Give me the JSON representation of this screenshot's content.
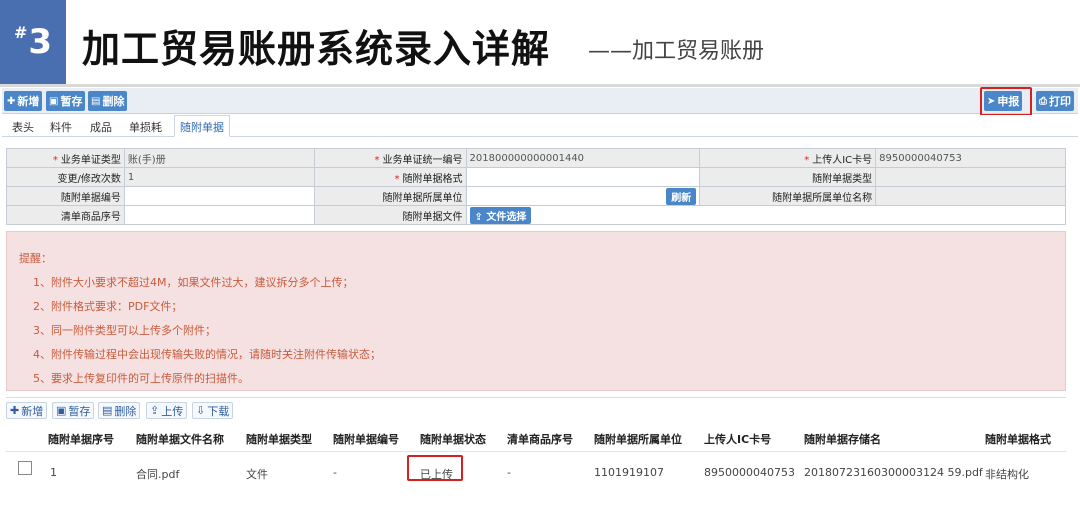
{
  "banner": {
    "badge_hash": "#",
    "badge_num": "3",
    "title": "加工贸易账册系统录入详解",
    "subtitle": "——加工贸易账册"
  },
  "toolbar": {
    "add": "新增",
    "save": "暂存",
    "delete": "删除",
    "declare": "申报",
    "print": "打印"
  },
  "tabs": [
    "表头",
    "料件",
    "成品",
    "单损耗",
    "随附单据"
  ],
  "form": {
    "row1": {
      "l1": "业务单证类型",
      "v1": "账(手)册",
      "l2": "业务单证统一编号",
      "v2": "201800000000001440",
      "l3": "上传人IC卡号",
      "v3": "8950000040753"
    },
    "row2": {
      "l1": "变更/修改次数",
      "v1": "1",
      "l2": "随附单据格式",
      "l3": "随附单据类型"
    },
    "row3": {
      "l1": "随附单据编号",
      "l2": "随附单据所属单位",
      "btn": "刷新",
      "l3": "随附单据所属单位名称"
    },
    "row4": {
      "l1": "清单商品序号",
      "l2": "随附单据文件",
      "btn": "文件选择"
    }
  },
  "notice": {
    "title": "提醒：",
    "items": [
      "1、附件大小要求不超过4M，如果文件过大，建议拆分多个上传；",
      "2、附件格式要求：PDF文件；",
      "3、同一附件类型可以上传多个附件；",
      "4、附件传输过程中会出现传输失败的情况，请随时关注附件传输状态；",
      "5、要求上传复印件的可上传原件的扫描件。"
    ]
  },
  "grid_toolbar": {
    "add": "新增",
    "save": "暂存",
    "delete": "删除",
    "upload": "上传",
    "download": "下载"
  },
  "grid": {
    "headers": [
      "随附单据序号",
      "随附单据文件名称",
      "随附单据类型",
      "随附单据编号",
      "随附单据状态",
      "清单商品序号",
      "随附单据所属单位",
      "上传人IC卡号",
      "随附单据存储名",
      "随附单据格式"
    ],
    "rows": [
      [
        "1",
        "合同.pdf",
        "文件",
        "-",
        "已上传",
        "-",
        "1101919107",
        "8950000040753",
        "20180723160300003124 59.pdf",
        "非结构化"
      ]
    ]
  },
  "colors": {
    "accent": "#4a86c8",
    "badge": "#4a6fb0",
    "highlight": "#d42020",
    "notice_bg": "#f5e1e1",
    "notice_text": "#c85a3c"
  }
}
